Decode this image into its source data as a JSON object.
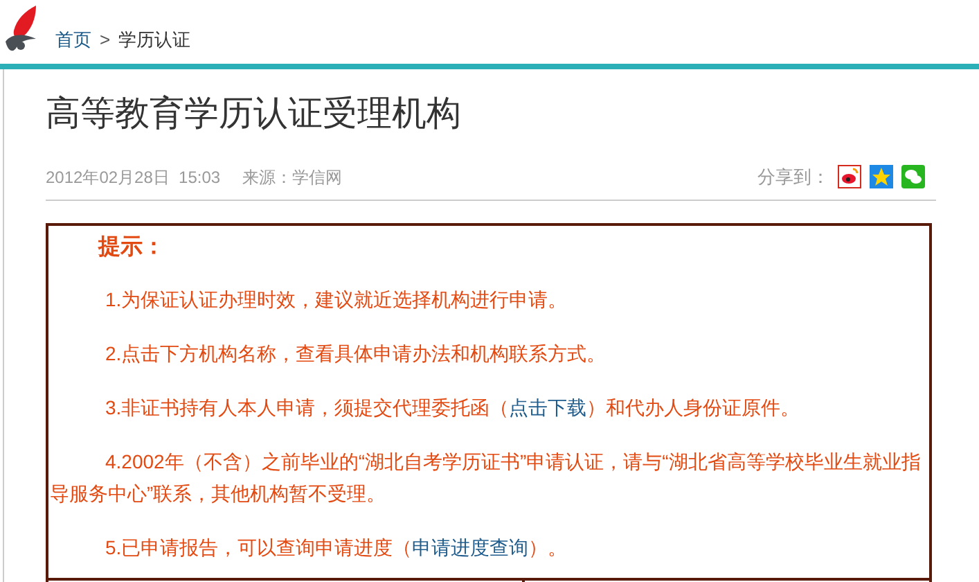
{
  "breadcrumb": [
    {
      "label": "首页",
      "kind": "link"
    },
    {
      "label": "学历认证",
      "kind": "current"
    }
  ],
  "breadcrumb_separator": ">",
  "title": "高等教育学历认证受理机构",
  "meta": {
    "date": "2012年02月28日  15:03",
    "source": "来源：学信网",
    "share_label": "分享到："
  },
  "notice": {
    "heading": "提示：",
    "paragraphs": [
      {
        "segments": [
          {
            "kind": "text",
            "text": "1.为保证认证办理时效，建议就近选择机构进行申请。"
          }
        ]
      },
      {
        "segments": [
          {
            "kind": "text",
            "text": "2.点击下方机构名称，查看具体申请办法和机构联系方式。"
          }
        ]
      },
      {
        "segments": [
          {
            "kind": "text",
            "text": "3.非证书持有人本人申请，须提交代理委托函（"
          },
          {
            "kind": "link",
            "text": "点击下载"
          },
          {
            "kind": "text",
            "text": "）和代办人身份证原件。"
          }
        ]
      },
      {
        "segments": [
          {
            "kind": "text",
            "text": "4.2002年（不含）之前毕业的“湖北自考学历证书”申请认证，请与“湖北省高等学校毕业生就业指导服务中心”联系，其他机构暂不受理。"
          }
        ]
      },
      {
        "segments": [
          {
            "kind": "text",
            "text": "5.已申请报告，可以查询申请进度（"
          },
          {
            "kind": "link",
            "text": "申请进度查询"
          },
          {
            "kind": "text",
            "text": "）。"
          }
        ]
      }
    ]
  }
}
